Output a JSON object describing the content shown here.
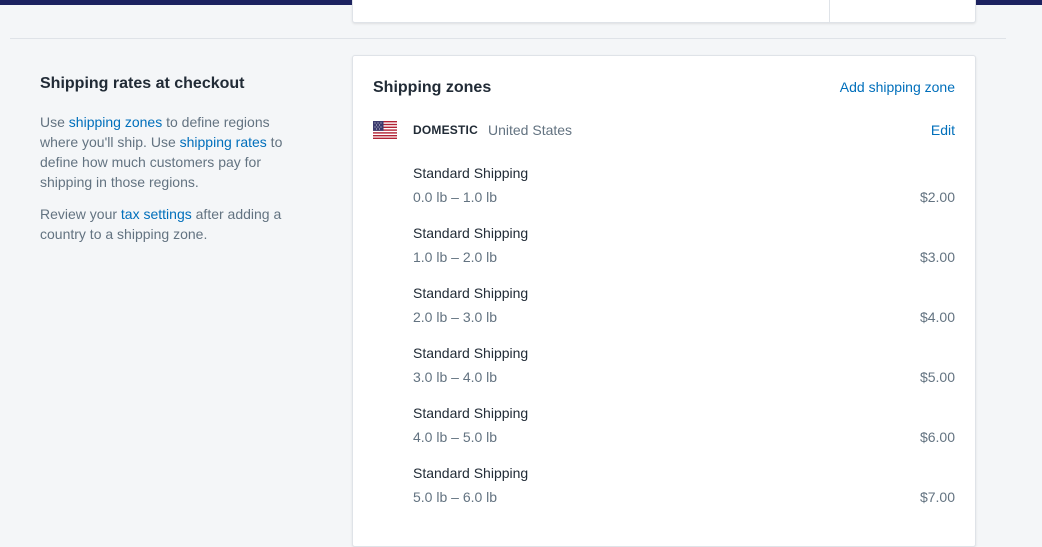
{
  "colors": {
    "topbar": "#1c2260",
    "link": "#006fbb",
    "text": "#212b36",
    "subdued": "#637381",
    "background": "#f4f6f8"
  },
  "section": {
    "title": "Shipping rates at checkout",
    "p1_use": "Use ",
    "p1_link_zones": "shipping zones",
    "p1_mid": " to define regions where you'll ship. Use ",
    "p1_link_rates": "shipping rates",
    "p1_end": " to define how much customers pay for shipping in those regions.",
    "p2_start": "Review your ",
    "p2_link_tax": "tax settings",
    "p2_end": " after adding a country to a shipping zone."
  },
  "card": {
    "title": "Shipping zones",
    "add_zone_label": "Add shipping zone"
  },
  "zone": {
    "flag_icon": "us-flag-icon",
    "type": "DOMESTIC",
    "country": "United States",
    "edit_label": "Edit",
    "rates": [
      {
        "name": "Standard Shipping",
        "range": "0.0 lb – 1.0 lb",
        "price": "$2.00"
      },
      {
        "name": "Standard Shipping",
        "range": "1.0 lb – 2.0 lb",
        "price": "$3.00"
      },
      {
        "name": "Standard Shipping",
        "range": "2.0 lb – 3.0 lb",
        "price": "$4.00"
      },
      {
        "name": "Standard Shipping",
        "range": "3.0 lb – 4.0 lb",
        "price": "$5.00"
      },
      {
        "name": "Standard Shipping",
        "range": "4.0 lb – 5.0 lb",
        "price": "$6.00"
      },
      {
        "name": "Standard Shipping",
        "range": "5.0 lb – 6.0 lb",
        "price": "$7.00"
      }
    ]
  }
}
